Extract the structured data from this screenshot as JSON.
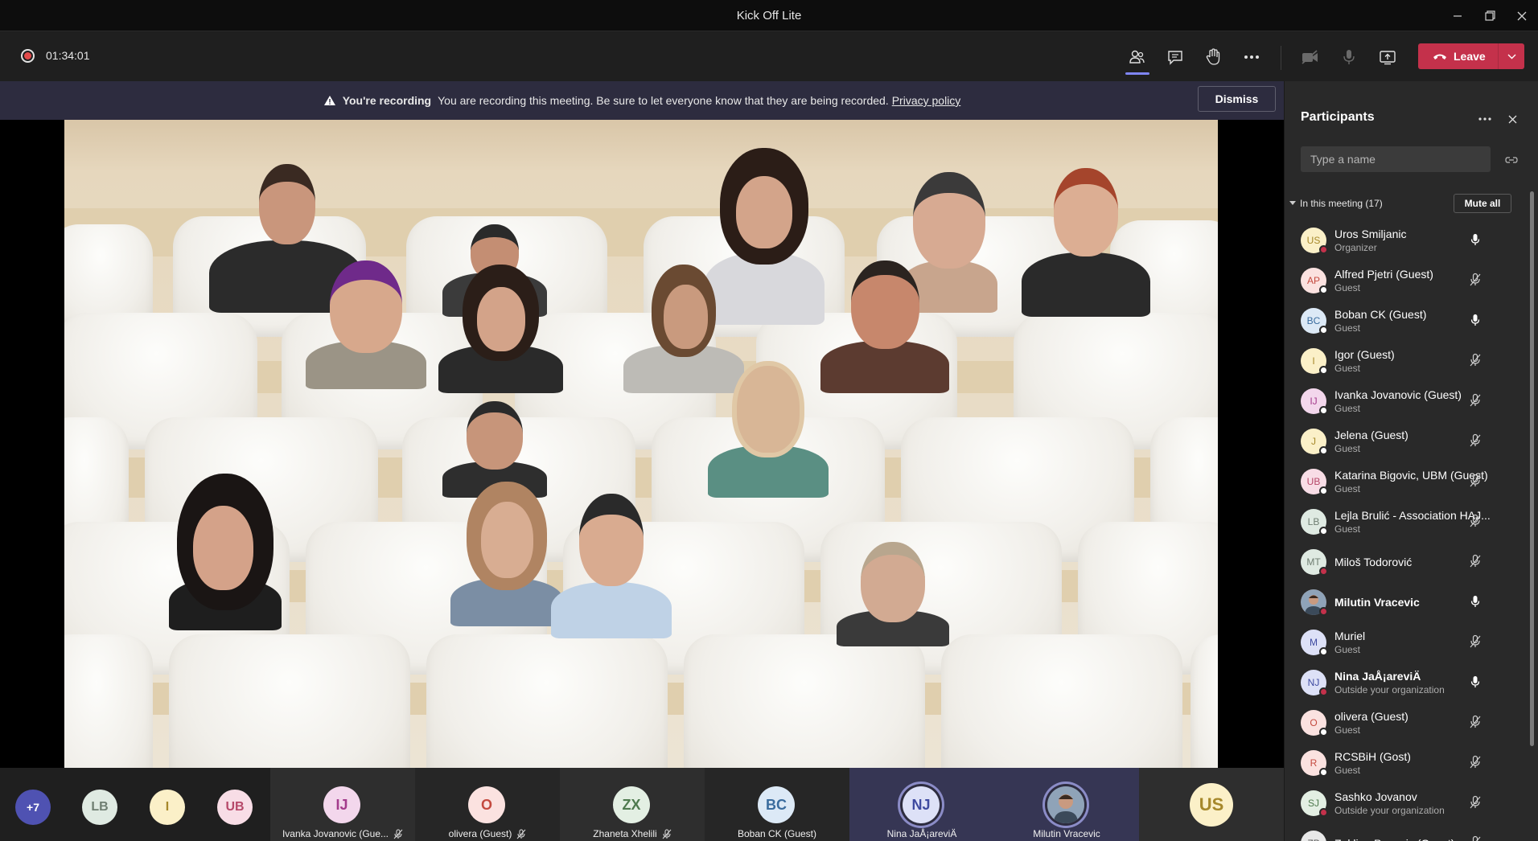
{
  "window": {
    "title": "Kick Off Lite",
    "controls": [
      "minimize-icon",
      "restore-icon",
      "close-icon"
    ]
  },
  "toolbar": {
    "timer": "01:34:01",
    "icons": [
      "participants-icon",
      "chat-icon",
      "raise-hand-icon",
      "more-icon",
      "camera-off-icon",
      "mic-icon",
      "share-screen-icon"
    ],
    "leave_label": "Leave"
  },
  "banner": {
    "title": "You're recording",
    "message": "You are recording this meeting. Be sure to let everyone know that they are being recorded.",
    "link": "Privacy policy",
    "dismiss_label": "Dismiss"
  },
  "thumbnails": {
    "overflow_count": "+7",
    "small_avatars": [
      {
        "initials": "LB",
        "bg": "#dfeae2",
        "fg": "#6f7e72"
      },
      {
        "initials": "I",
        "bg": "#fbf0c8",
        "fg": "#a6882a"
      },
      {
        "initials": "UB",
        "bg": "#f8dde6",
        "fg": "#b64869"
      }
    ],
    "tiles": [
      {
        "initials": "IJ",
        "name": "Ivanka Jovanovic (Gue...",
        "bg": "#f3d7ec",
        "fg": "#a33b8b",
        "muted": true
      },
      {
        "initials": "O",
        "name": "olivera (Guest)",
        "bg": "#fbe2e0",
        "fg": "#c44a3f",
        "muted": true
      },
      {
        "initials": "ZX",
        "name": "Zhaneta Xhelili",
        "bg": "#e3efe3",
        "fg": "#4e7a4e",
        "muted": true
      },
      {
        "initials": "BC",
        "name": "Boban CK (Guest)",
        "bg": "#dce9f6",
        "fg": "#3a6c9e",
        "muted": false
      },
      {
        "initials": "NJ",
        "name": "Nina JaÅ¡areviÄ",
        "bg": "#dde1f7",
        "fg": "#3e4aa0",
        "muted": false
      },
      {
        "initials": "",
        "name": "Milutin Vracevic",
        "bg": "#8a6a5a",
        "fg": "#ffffff",
        "muted": false
      },
      {
        "initials": "US",
        "name": "",
        "bg": "#fbf0c8",
        "fg": "#a6882a",
        "muted": false
      }
    ]
  },
  "panel": {
    "title": "Participants",
    "search_placeholder": "Type a name",
    "section": "In this meeting (17)",
    "mute_all": "Mute all",
    "participants": [
      {
        "initials": "US",
        "name": "Uros Smiljanic",
        "role": "Organizer",
        "bg": "#fbf0c8",
        "fg": "#a6882a",
        "status": "#c4314b",
        "mic": "on",
        "bold": false
      },
      {
        "initials": "AP",
        "name": "Alfred Pjetri (Guest)",
        "role": "Guest",
        "bg": "#fbe2e0",
        "fg": "#c44a3f",
        "status": "#ffffff",
        "mic": "off",
        "bold": false
      },
      {
        "initials": "BC",
        "name": "Boban CK (Guest)",
        "role": "Guest",
        "bg": "#dce9f6",
        "fg": "#3a6c9e",
        "status": "#ffffff",
        "mic": "on",
        "bold": false
      },
      {
        "initials": "I",
        "name": "Igor (Guest)",
        "role": "Guest",
        "bg": "#fbf0c8",
        "fg": "#a6882a",
        "status": "#ffffff",
        "mic": "off",
        "bold": false
      },
      {
        "initials": "IJ",
        "name": "Ivanka Jovanovic (Guest)",
        "role": "Guest",
        "bg": "#f3d7ec",
        "fg": "#a33b8b",
        "status": "#ffffff",
        "mic": "off",
        "bold": false
      },
      {
        "initials": "J",
        "name": "Jelena (Guest)",
        "role": "Guest",
        "bg": "#fbf0c8",
        "fg": "#a6882a",
        "status": "#ffffff",
        "mic": "off",
        "bold": false
      },
      {
        "initials": "UB",
        "name": "Katarina Bigovic, UBM (Guest)",
        "role": "Guest",
        "bg": "#f8dde6",
        "fg": "#b64869",
        "status": "#ffffff",
        "mic": "off",
        "bold": false
      },
      {
        "initials": "LB",
        "name": "Lejla Brulić - Association HAJ...",
        "role": "Guest",
        "bg": "#dfeae2",
        "fg": "#6f7e72",
        "status": "#ffffff",
        "mic": "off",
        "bold": false
      },
      {
        "initials": "MT",
        "name": "Miloš Todorović",
        "role": "",
        "bg": "#dfeae2",
        "fg": "#6f7e72",
        "status": "#c4314b",
        "mic": "off",
        "bold": false
      },
      {
        "initials": "",
        "name": "Milutin Vracevic",
        "role": "",
        "bg": "#8a6a5a",
        "fg": "#ffffff",
        "status": "#c4314b",
        "mic": "on",
        "bold": true
      },
      {
        "initials": "M",
        "name": "Muriel",
        "role": "Guest",
        "bg": "#dde1f7",
        "fg": "#3e4aa0",
        "status": "#ffffff",
        "mic": "off",
        "bold": false
      },
      {
        "initials": "NJ",
        "name": "Nina JaÅ¡areviÄ",
        "role": "Outside your organization",
        "bg": "#dde1f7",
        "fg": "#3e4aa0",
        "status": "#c4314b",
        "mic": "on",
        "bold": true
      },
      {
        "initials": "O",
        "name": "olivera (Guest)",
        "role": "Guest",
        "bg": "#fbe2e0",
        "fg": "#c44a3f",
        "status": "#ffffff",
        "mic": "off",
        "bold": false
      },
      {
        "initials": "R",
        "name": "RCSBiH (Gost)",
        "role": "Guest",
        "bg": "#fbe2e0",
        "fg": "#c44a3f",
        "status": "#ffffff",
        "mic": "off",
        "bold": false
      },
      {
        "initials": "SJ",
        "name": "Sashko Jovanov",
        "role": "Outside your organization",
        "bg": "#e3efe3",
        "fg": "#4e7a4e",
        "status": "#c4314b",
        "mic": "off",
        "bold": false
      },
      {
        "initials": "ZP",
        "name": "Zaklina Popovic (Guest)",
        "role": "",
        "bg": "#e8e8e8",
        "fg": "#555555",
        "status": "#ffffff",
        "mic": "off",
        "bold": false
      }
    ]
  }
}
